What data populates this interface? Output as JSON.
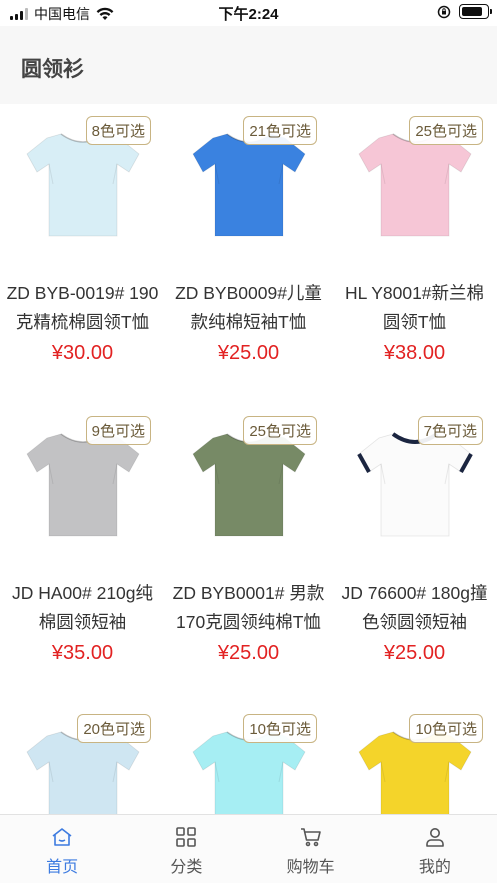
{
  "status_bar": {
    "carrier": "中国电信",
    "time": "下午2:24"
  },
  "header": {
    "title": "圆领衫"
  },
  "products": [
    {
      "badge": "8色可选",
      "name": "ZD BYB-0019# 190克精梳棉圆领T恤",
      "price": "¥30.00",
      "color": "#d8eef6",
      "ring": ""
    },
    {
      "badge": "21色可选",
      "name": "ZD BYB0009#儿童款纯棉短袖T恤",
      "price": "¥25.00",
      "color": "#3a82e0",
      "ring": ""
    },
    {
      "badge": "25色可选",
      "name": "HL Y8001#新兰棉圆领T恤",
      "price": "¥38.00",
      "color": "#f6c6d6",
      "ring": ""
    },
    {
      "badge": "9色可选",
      "name": "JD HA00# 210g纯棉圆领短袖",
      "price": "¥35.00",
      "color": "#c2c2c4",
      "ring": ""
    },
    {
      "badge": "25色可选",
      "name": "ZD BYB0001# 男款170克圆领纯棉T恤",
      "price": "¥25.00",
      "color": "#778a66",
      "ring": ""
    },
    {
      "badge": "7色可选",
      "name": "JD 76600# 180g撞色领圆领短袖",
      "price": "¥25.00",
      "color": "#fbfbfb",
      "ring": "#1b2540"
    },
    {
      "badge": "20色可选",
      "name": "",
      "price": "",
      "color": "#cfe6f2",
      "ring": ""
    },
    {
      "badge": "10色可选",
      "name": "",
      "price": "",
      "color": "#a6eef3",
      "ring": ""
    },
    {
      "badge": "10色可选",
      "name": "",
      "price": "",
      "color": "#f4d42a",
      "ring": ""
    }
  ],
  "tabbar": {
    "items": [
      {
        "label": "首页",
        "icon": "home-icon",
        "active": true
      },
      {
        "label": "分类",
        "icon": "category-icon",
        "active": false
      },
      {
        "label": "购物车",
        "icon": "cart-icon",
        "active": false
      },
      {
        "label": "我的",
        "icon": "user-icon",
        "active": false
      }
    ],
    "active_color": "#3d7be0"
  }
}
